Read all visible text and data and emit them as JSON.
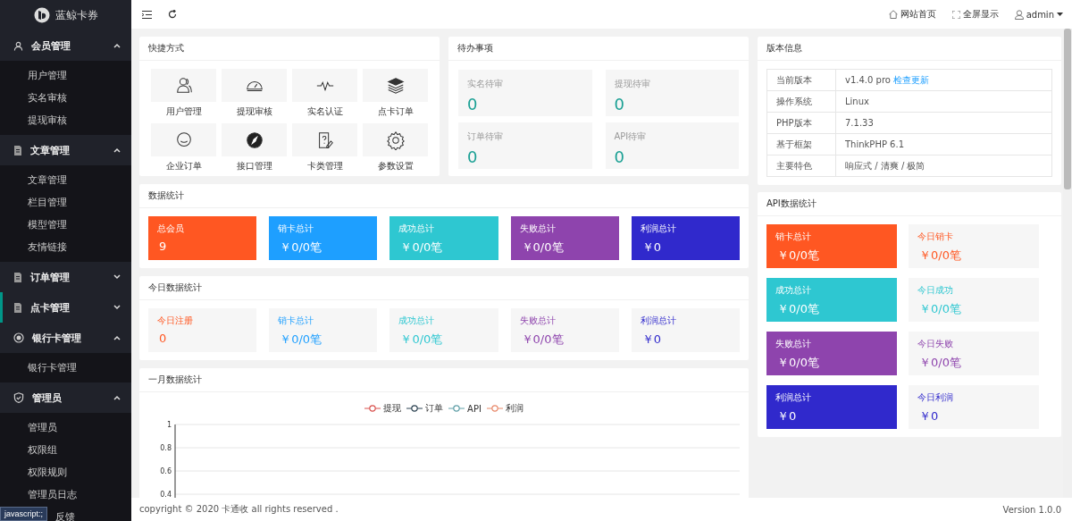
{
  "sidebar": {
    "logo": "蓝鲸卡券",
    "groups": [
      {
        "label": "会员管理",
        "expanded": true,
        "selected": false,
        "items": [
          "用户管理",
          "实名审核",
          "提现审核"
        ]
      },
      {
        "label": "文章管理",
        "expanded": true,
        "selected": false,
        "items": [
          "文章管理",
          "栏目管理",
          "模型管理",
          "友情链接"
        ]
      },
      {
        "label": "订单管理",
        "expanded": false,
        "selected": false
      },
      {
        "label": "点卡管理",
        "expanded": false,
        "selected": true
      },
      {
        "label": "银行卡管理",
        "expanded": true,
        "selected": false,
        "items": [
          "银行卡管理"
        ]
      },
      {
        "label": "管理员",
        "expanded": true,
        "selected": false,
        "items": [
          "管理员",
          "权限组",
          "权限规则",
          "管理员日志",
          "反馈"
        ]
      }
    ]
  },
  "status_tip": "javascript:;",
  "header": {
    "links": [
      "网站首页",
      "全屏显示"
    ],
    "user": "admin"
  },
  "shortcuts": {
    "title": "快捷方式",
    "items": [
      "用户管理",
      "提现审核",
      "实名认证",
      "点卡订单",
      "企业订单",
      "接口管理",
      "卡类管理",
      "参数设置"
    ]
  },
  "todo": {
    "title": "待办事项",
    "items": [
      {
        "label": "实名待审",
        "value": "0"
      },
      {
        "label": "提现待审",
        "value": "0"
      },
      {
        "label": "订单待审",
        "value": "0"
      },
      {
        "label": "API待审",
        "value": "0"
      }
    ]
  },
  "version": {
    "title": "版本信息",
    "rows": [
      {
        "label": "当前版本",
        "value": "v1.4.0 pro",
        "link": "检查更新"
      },
      {
        "label": "操作系统",
        "value": "Linux"
      },
      {
        "label": "PHP版本",
        "value": "7.1.33"
      },
      {
        "label": "基于框架",
        "value": "ThinkPHP 6.1"
      },
      {
        "label": "主要特色",
        "value": "响应式 / 清爽 / 极简"
      }
    ]
  },
  "stats": {
    "title": "数据统计",
    "tiles": [
      {
        "label": "总会员",
        "value": "9",
        "color": "#ff5722"
      },
      {
        "label": "销卡总计",
        "value": "￥0/0笔",
        "color": "#1e9fff"
      },
      {
        "label": "成功总计",
        "value": "￥0/0笔",
        "color": "#2ec7d1"
      },
      {
        "label": "失败总计",
        "value": "￥0/0笔",
        "color": "#8e44ad"
      },
      {
        "label": "利润总计",
        "value": "￥0",
        "color": "#3029cc"
      }
    ]
  },
  "today": {
    "title": "今日数据统计",
    "tiles": [
      {
        "label": "今日注册",
        "value": "0",
        "color": "#ff5722"
      },
      {
        "label": "销卡总计",
        "value": "￥0/0笔",
        "color": "#1e9fff"
      },
      {
        "label": "成功总计",
        "value": "￥0/0笔",
        "color": "#2ec7d1"
      },
      {
        "label": "失败总计",
        "value": "￥0/0笔",
        "color": "#8e44ad"
      },
      {
        "label": "利润总计",
        "value": "￥0",
        "color": "#3029cc"
      }
    ]
  },
  "monthly": {
    "title": "一月数据统计",
    "chart_data": {
      "type": "line",
      "grid": true,
      "ylim": [
        0,
        1
      ],
      "yticks": [
        0.4,
        0.6,
        0.8,
        1
      ],
      "series": [
        {
          "name": "提现",
          "color": "#d9534f"
        },
        {
          "name": "订单",
          "color": "#2f4554"
        },
        {
          "name": "API",
          "color": "#61a0a8"
        },
        {
          "name": "利润",
          "color": "#e8896b"
        }
      ]
    }
  },
  "api_stats": {
    "title": "API数据统计",
    "rows": [
      {
        "total": {
          "label": "销卡总计",
          "value": "￥0/0笔"
        },
        "today": {
          "label": "今日销卡",
          "value": "￥0/0笔"
        },
        "color": "#ff5722"
      },
      {
        "total": {
          "label": "成功总计",
          "value": "￥0/0笔"
        },
        "today": {
          "label": "今日成功",
          "value": "￥0/0笔"
        },
        "color": "#2ec7d1"
      },
      {
        "total": {
          "label": "失败总计",
          "value": "￥0/0笔"
        },
        "today": {
          "label": "今日失败",
          "value": "￥0/0笔"
        },
        "color": "#8e44ad"
      },
      {
        "total": {
          "label": "利润总计",
          "value": "￥0"
        },
        "today": {
          "label": "今日利润",
          "value": "￥0"
        },
        "color": "#3029cc"
      }
    ]
  },
  "footer": {
    "copyright": "copyright © 2020 卡通收 all rights reserved .",
    "version": "Version 1.0.0"
  }
}
